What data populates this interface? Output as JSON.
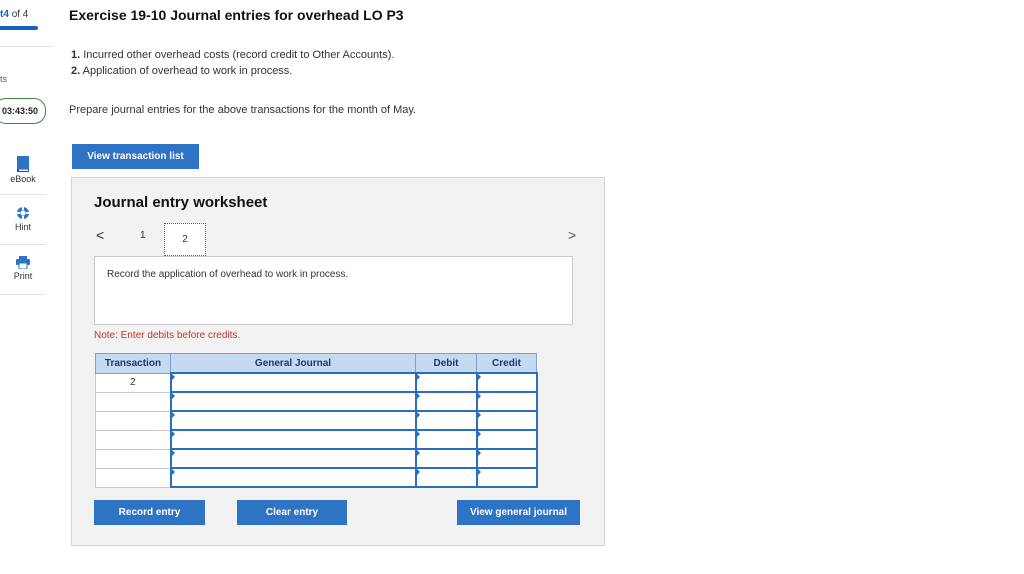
{
  "sidebar": {
    "progress_prefix": "t",
    "progress_current": "4",
    "progress_of": "of 4",
    "progress_fraction": 1.0,
    "points_label": "ts",
    "timer": "03:43:50",
    "items": [
      {
        "label": "eBook",
        "icon": "book-icon"
      },
      {
        "label": "Hint",
        "icon": "lifebuoy-icon"
      },
      {
        "label": "Print",
        "icon": "printer-icon"
      }
    ]
  },
  "exercise": {
    "title": "Exercise 19-10 Journal entries for overhead LO P3",
    "items": [
      {
        "num": "1.",
        "text": "Incurred other overhead costs (record credit to Other Accounts)."
      },
      {
        "num": "2.",
        "text": "Application of overhead to work in process."
      }
    ],
    "instructions": "Prepare journal entries for the above transactions for the month of May."
  },
  "buttons": {
    "view_transaction_list": "View transaction list",
    "record_entry": "Record entry",
    "clear_entry": "Clear entry",
    "view_general_journal": "View general journal"
  },
  "worksheet": {
    "title": "Journal entry worksheet",
    "prev": "<",
    "next": ">",
    "pages": [
      "1",
      "2"
    ],
    "active_page": "2",
    "entry_description": "Record the application of overhead to work in process.",
    "note": "Note: Enter debits before credits.",
    "table": {
      "headers": [
        "Transaction",
        "General Journal",
        "Debit",
        "Credit"
      ],
      "rows": [
        {
          "transaction": "2",
          "account": "",
          "debit": "",
          "credit": ""
        },
        {
          "transaction": "",
          "account": "",
          "debit": "",
          "credit": ""
        },
        {
          "transaction": "",
          "account": "",
          "debit": "",
          "credit": ""
        },
        {
          "transaction": "",
          "account": "",
          "debit": "",
          "credit": ""
        },
        {
          "transaction": "",
          "account": "",
          "debit": "",
          "credit": ""
        },
        {
          "transaction": "",
          "account": "",
          "debit": "",
          "credit": ""
        }
      ]
    }
  },
  "colors": {
    "accent": "#2f73c5",
    "table_header": "#c5d9f1",
    "note": "#c0392b",
    "timer_border": "#3d8b3d"
  }
}
